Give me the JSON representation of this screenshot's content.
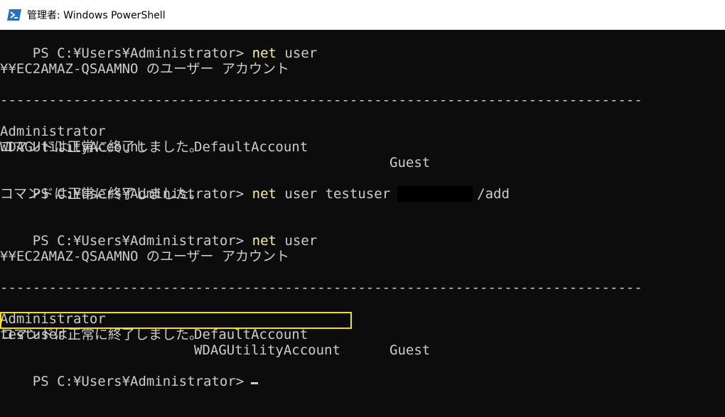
{
  "window": {
    "title": "管理者: Windows PowerShell"
  },
  "console": {
    "prompt": "PS C:¥Users¥Administrator>",
    "cmd_net": "net",
    "cmd_user_arg": "user",
    "cmd_user_add_arg": "user testuser",
    "cmd_add_flag": "/add",
    "accounts_header": "¥¥EC2AMAZ-QSAAMNO のユーザー アカウント",
    "separator": "-------------------------------------------------------------------------------",
    "success": "コマンドは正常に終了しました。",
    "list1": {
      "row1": [
        "Administrator",
        "DefaultAccount",
        "Guest"
      ],
      "row2": [
        "WDAGUtilityAccount"
      ]
    },
    "list2": {
      "row1": [
        "Administrator",
        "DefaultAccount",
        "Guest"
      ],
      "row2": [
        "testuser",
        "WDAGUtilityAccount"
      ]
    }
  },
  "colors": {
    "background": "#0c0c0c",
    "text": "#cccccc",
    "command": "#f9f1a5",
    "highlight_box": "#f5e100"
  },
  "icons": {
    "title": "powershell-icon"
  }
}
